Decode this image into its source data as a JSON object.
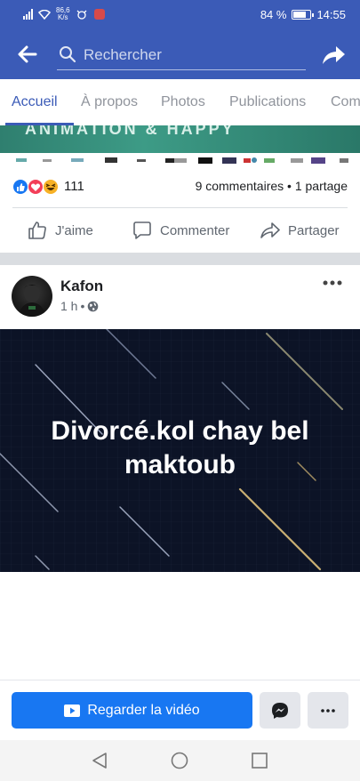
{
  "status_bar": {
    "network_speed": "86,6",
    "network_unit": "K/s",
    "signal_label": "36",
    "battery_percent": "84 %",
    "battery_level": 0.84,
    "time": "14:55"
  },
  "header": {
    "search_placeholder": "Rechercher",
    "background_color": "#3b5bb7"
  },
  "tabs": [
    {
      "label": "Accueil",
      "active": true
    },
    {
      "label": "À propos",
      "active": false
    },
    {
      "label": "Photos",
      "active": false
    },
    {
      "label": "Publications",
      "active": false
    },
    {
      "label": "Com",
      "active": false
    }
  ],
  "banner": {
    "text": "ANIMATION & HAPPY"
  },
  "reactions": {
    "icons": [
      "like-icon",
      "love-icon",
      "haha-icon"
    ],
    "count": "111",
    "comments_shares": "9 commentaires • 1 partage"
  },
  "actions": {
    "like_label": "J'aime",
    "comment_label": "Commenter",
    "share_label": "Partager"
  },
  "post": {
    "author": "Kafon",
    "time": "1 h",
    "separator": "•",
    "privacy_icon": "globe-icon",
    "video_title": "Divorcé.kol chay bel maktoub"
  },
  "bottom_bar": {
    "watch_label": "Regarder la vidéo",
    "accent_color": "#1877f2"
  },
  "navbar": {
    "icons": [
      "back-triangle-icon",
      "home-circle-icon",
      "recents-square-icon"
    ]
  }
}
